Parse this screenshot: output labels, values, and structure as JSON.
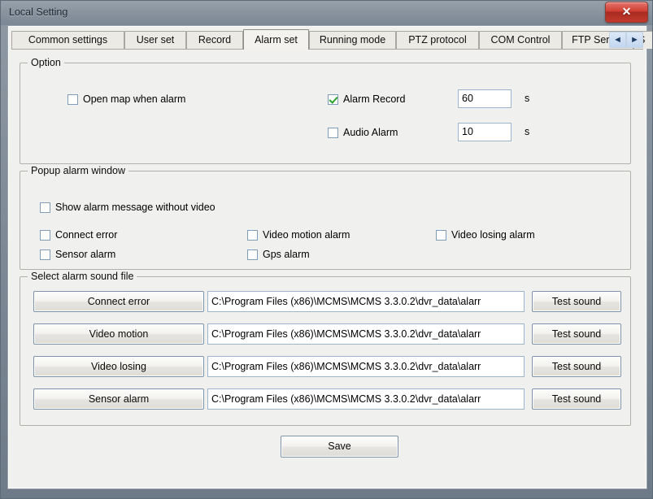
{
  "window": {
    "title": "Local Setting",
    "close_glyph": "✕"
  },
  "tabs": {
    "items": [
      {
        "label": "Common settings",
        "active": false
      },
      {
        "label": "User set",
        "active": false
      },
      {
        "label": "Record",
        "active": false
      },
      {
        "label": "Alarm set",
        "active": true
      },
      {
        "label": "Running mode",
        "active": false
      },
      {
        "label": "PTZ protocol",
        "active": false
      },
      {
        "label": "COM Control",
        "active": false
      },
      {
        "label": "FTP Server",
        "active": false
      },
      {
        "label": "S",
        "active": false
      }
    ],
    "scroll_left": "◄",
    "scroll_right": "►"
  },
  "option_group": {
    "title": "Option",
    "open_map": {
      "label": "Open map when alarm",
      "checked": false
    },
    "alarm_record": {
      "label": "Alarm Record",
      "checked": true,
      "value": "60",
      "unit": "s"
    },
    "audio_alarm": {
      "label": "Audio Alarm",
      "checked": false,
      "value": "10",
      "unit": "s"
    }
  },
  "popup_group": {
    "title": "Popup alarm window",
    "show_message": {
      "label": "Show alarm message without video",
      "checked": false
    },
    "checks": [
      {
        "label": "Connect error",
        "checked": false
      },
      {
        "label": "Video motion alarm",
        "checked": false
      },
      {
        "label": "Video losing alarm",
        "checked": false
      },
      {
        "label": "Sensor alarm",
        "checked": false
      },
      {
        "label": "Gps alarm",
        "checked": false
      }
    ]
  },
  "sound_group": {
    "title": "Select alarm sound file",
    "test_label": "Test sound",
    "rows": [
      {
        "button": "Connect error",
        "path": "C:\\Program Files (x86)\\MCMS\\MCMS 3.3.0.2\\dvr_data\\alarr",
        "test": "Test sound"
      },
      {
        "button": "Video motion",
        "path": "C:\\Program Files (x86)\\MCMS\\MCMS 3.3.0.2\\dvr_data\\alarr",
        "test": "Test sound"
      },
      {
        "button": "Video losing",
        "path": "C:\\Program Files (x86)\\MCMS\\MCMS 3.3.0.2\\dvr_data\\alarr",
        "test": "Test sound"
      },
      {
        "button": "Sensor alarm",
        "path": "C:\\Program Files (x86)\\MCMS\\MCMS 3.3.0.2\\dvr_data\\alarr",
        "test": "Test sound"
      }
    ]
  },
  "save_button": {
    "label": "Save"
  },
  "colors": {
    "titlebar": "#7b8794",
    "close_red": "#cf3f33",
    "client_bg": "#f0f0ee",
    "check_green": "#2ba02b",
    "tab_nav_blue": "#c3d7f0"
  }
}
